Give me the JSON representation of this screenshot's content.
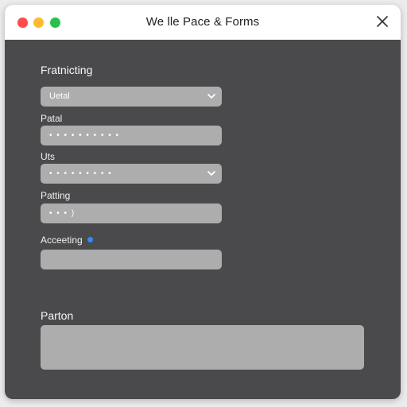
{
  "window": {
    "title": "We lle Pace & Forms",
    "controls": {
      "close_color": "#ff4b4b",
      "minimize_color": "#fbbd2e",
      "maximize_color": "#29c04a"
    }
  },
  "form": {
    "section_title": "Fratnicting",
    "select_1": {
      "value": "Uetal"
    },
    "field_1": {
      "label": "Patal",
      "value": "• • • • • • • • • •"
    },
    "field_2": {
      "label": "Uts",
      "value": "• • • • • • • • •"
    },
    "field_3": {
      "label": "Patting",
      "value": "• • • )"
    },
    "field_4": {
      "label": "Acceeting",
      "value": ""
    },
    "notes": {
      "label": "Parton",
      "value": ""
    }
  },
  "colors": {
    "panel_bg": "#4a4a4c",
    "field_bg": "#adadad",
    "info_dot": "#2f8bff"
  }
}
